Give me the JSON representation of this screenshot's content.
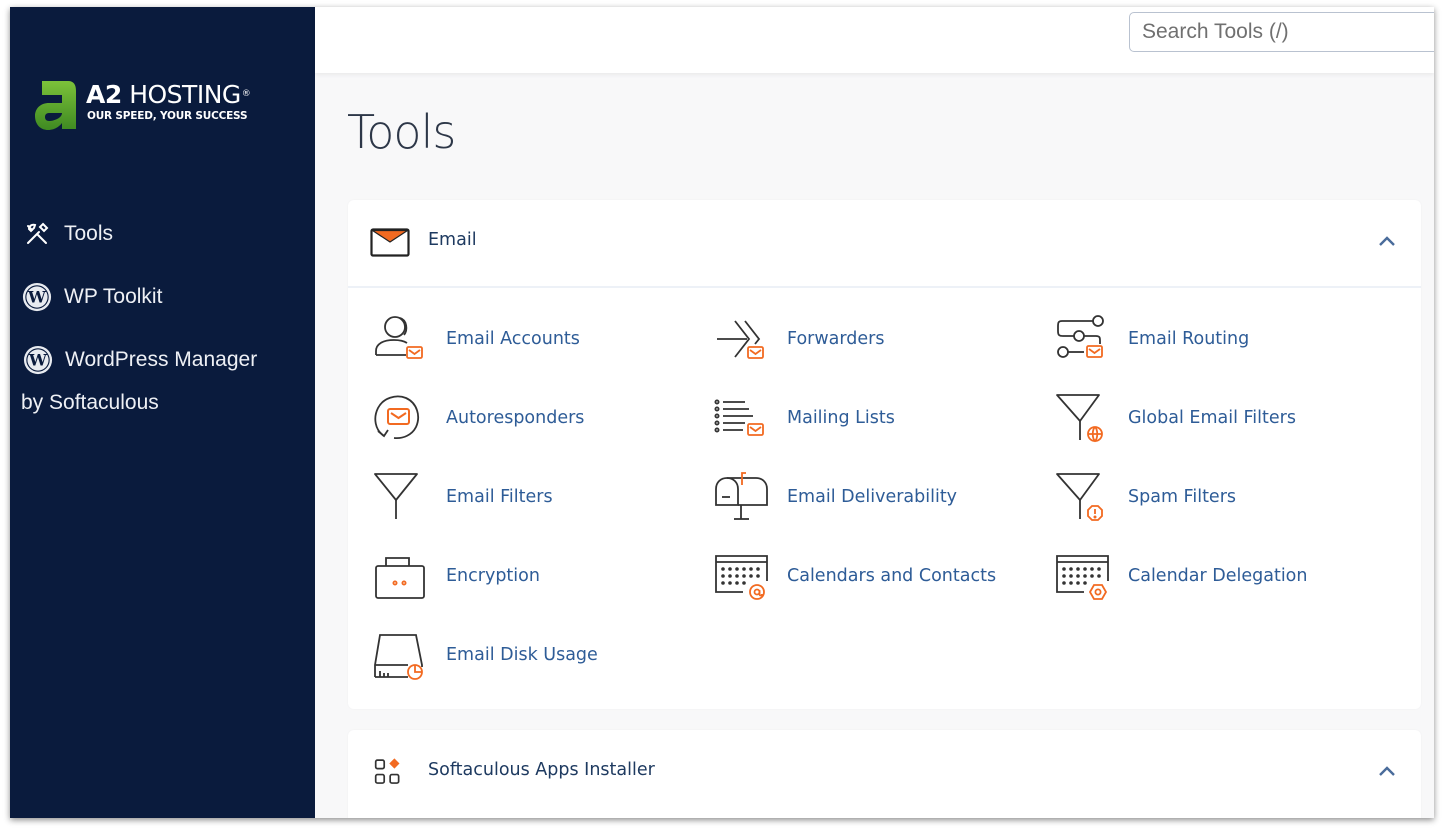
{
  "brand": {
    "name_bold": "A2",
    "name_rest": "HOSTING",
    "registered": "®",
    "tagline": "OUR SPEED, YOUR SUCCESS",
    "logo_icon": "a2-logo-icon",
    "colors": {
      "sidebar": "#0a1b3d",
      "logo_green": "#6ab42d"
    }
  },
  "sidebar": {
    "items": [
      {
        "label": "Tools",
        "icon": "tools-icon"
      },
      {
        "label": "WP Toolkit",
        "icon": "wordpress-icon"
      },
      {
        "label": "WordPress Manager",
        "sublabel": "by Softaculous",
        "icon": "wordpress-icon"
      }
    ]
  },
  "header": {
    "search_placeholder": "Search Tools (/)",
    "search_value": ""
  },
  "page": {
    "title": "Tools"
  },
  "colors": {
    "accent_orange": "#f26a21",
    "link_blue": "#2e5c97",
    "icon_dark": "#333333"
  },
  "sections": [
    {
      "title": "Email",
      "icon": "envelope-icon",
      "expanded": true,
      "tools": [
        {
          "label": "Email Accounts",
          "icon": "email-accounts-icon"
        },
        {
          "label": "Forwarders",
          "icon": "forwarders-icon"
        },
        {
          "label": "Email Routing",
          "icon": "email-routing-icon"
        },
        {
          "label": "Autoresponders",
          "icon": "autoresponders-icon"
        },
        {
          "label": "Mailing Lists",
          "icon": "mailing-lists-icon"
        },
        {
          "label": "Global Email Filters",
          "icon": "global-email-filters-icon"
        },
        {
          "label": "Email Filters",
          "icon": "email-filters-icon"
        },
        {
          "label": "Email Deliverability",
          "icon": "mailbox-icon"
        },
        {
          "label": "Spam Filters",
          "icon": "spam-filters-icon"
        },
        {
          "label": "Encryption",
          "icon": "encryption-icon"
        },
        {
          "label": "Calendars and Contacts",
          "icon": "calendar-contacts-icon"
        },
        {
          "label": "Calendar Delegation",
          "icon": "calendar-delegation-icon"
        },
        {
          "label": "Email Disk Usage",
          "icon": "disk-usage-icon"
        }
      ]
    },
    {
      "title": "Softaculous Apps Installer",
      "icon": "apps-grid-icon",
      "expanded": true,
      "tools": []
    }
  ]
}
